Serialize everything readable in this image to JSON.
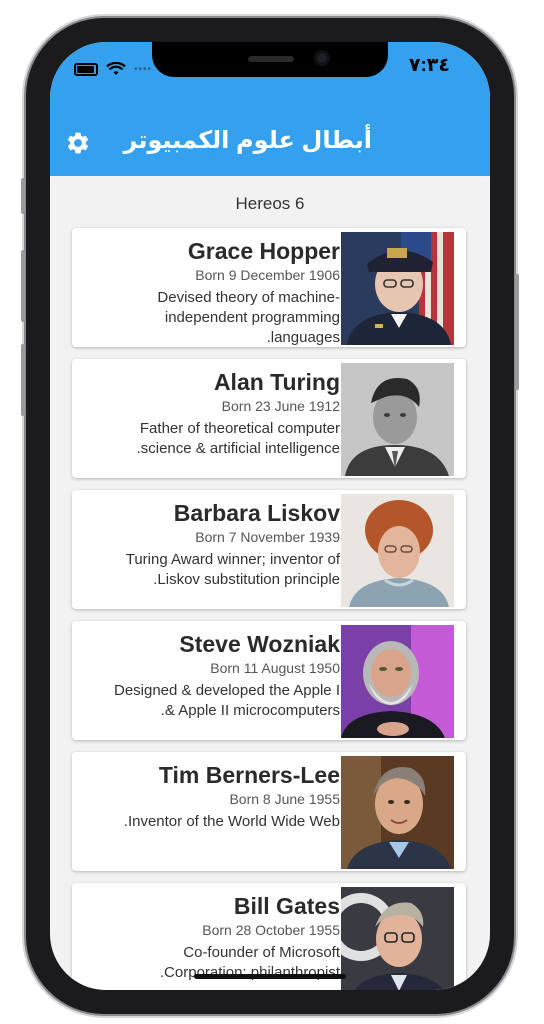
{
  "status": {
    "time": "٧:٣٤"
  },
  "appbar": {
    "title": "أبطال علوم الكمبيوتر",
    "settings_icon": "gear-icon"
  },
  "list_header": "Hereos 6",
  "heroes": [
    {
      "name": "Grace Hopper",
      "born": "Born 9 December 1906",
      "desc_lines": [
        "Devised theory of machine-",
        "independent programming",
        ".languages"
      ]
    },
    {
      "name": "Alan Turing",
      "born": "Born 23 June 1912",
      "desc_lines": [
        "Father of theoretical computer",
        ".science & artificial intelligence"
      ]
    },
    {
      "name": "Barbara Liskov",
      "born": "Born 7 November 1939",
      "desc_lines": [
        "Turing Award winner; inventor of",
        ".Liskov substitution principle"
      ]
    },
    {
      "name": "Steve Wozniak",
      "born": "Born 11 August 1950",
      "desc_lines": [
        "Designed & developed the Apple I",
        ".& Apple II microcomputers"
      ]
    },
    {
      "name": "Tim Berners-Lee",
      "born": "Born 8 June 1955",
      "desc_lines": [
        ".Inventor of the World Wide Web"
      ]
    },
    {
      "name": "Bill Gates",
      "born": "Born 28 October 1955",
      "desc_lines": [
        "Co-founder of Microsoft",
        ".Corporation; philanthropist"
      ]
    }
  ],
  "colors": {
    "appbar": "#35a1ee",
    "background": "#f2f2f2",
    "card": "#ffffff"
  }
}
